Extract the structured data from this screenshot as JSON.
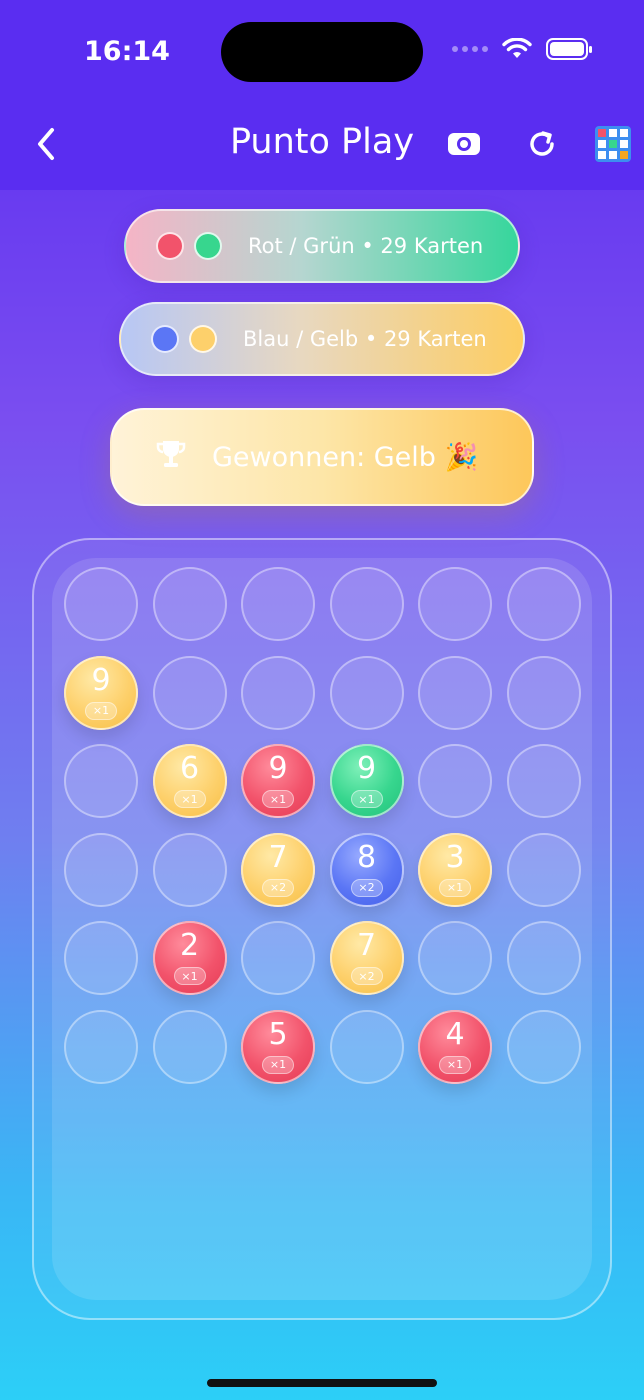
{
  "status": {
    "time": "16:14"
  },
  "nav": {
    "title": "Punto Play",
    "icons": [
      "back-chevron-icon",
      "camera-flip-icon",
      "refresh-icon",
      "grid-board-icon"
    ]
  },
  "players": [
    {
      "label": "Rot / Grün • 29 Karten",
      "colors": [
        "#f2536b",
        "#37d68e"
      ]
    },
    {
      "label": "Blau / Gelb • 29 Karten",
      "colors": [
        "#5b76f5",
        "#fdd06b"
      ]
    }
  ],
  "winner": {
    "label": "Gewonnen: Gelb 🎉"
  },
  "board": {
    "rows": 6,
    "cols": 6,
    "cards": [
      {
        "row": 1,
        "col": 0,
        "color": "yellow",
        "value": "9",
        "mult": "×1"
      },
      {
        "row": 2,
        "col": 1,
        "color": "yellow",
        "value": "6",
        "mult": "×1"
      },
      {
        "row": 2,
        "col": 2,
        "color": "red",
        "value": "9",
        "mult": "×1"
      },
      {
        "row": 2,
        "col": 3,
        "color": "green",
        "value": "9",
        "mult": "×1"
      },
      {
        "row": 3,
        "col": 2,
        "color": "yellow",
        "value": "7",
        "mult": "×2"
      },
      {
        "row": 3,
        "col": 3,
        "color": "blue",
        "value": "8",
        "mult": "×2"
      },
      {
        "row": 3,
        "col": 4,
        "color": "yellow",
        "value": "3",
        "mult": "×1"
      },
      {
        "row": 4,
        "col": 1,
        "color": "red",
        "value": "2",
        "mult": "×1"
      },
      {
        "row": 4,
        "col": 3,
        "color": "yellow",
        "value": "7",
        "mult": "×2"
      },
      {
        "row": 5,
        "col": 2,
        "color": "red",
        "value": "5",
        "mult": "×1"
      },
      {
        "row": 5,
        "col": 4,
        "color": "red",
        "value": "4",
        "mult": "×1"
      }
    ]
  }
}
